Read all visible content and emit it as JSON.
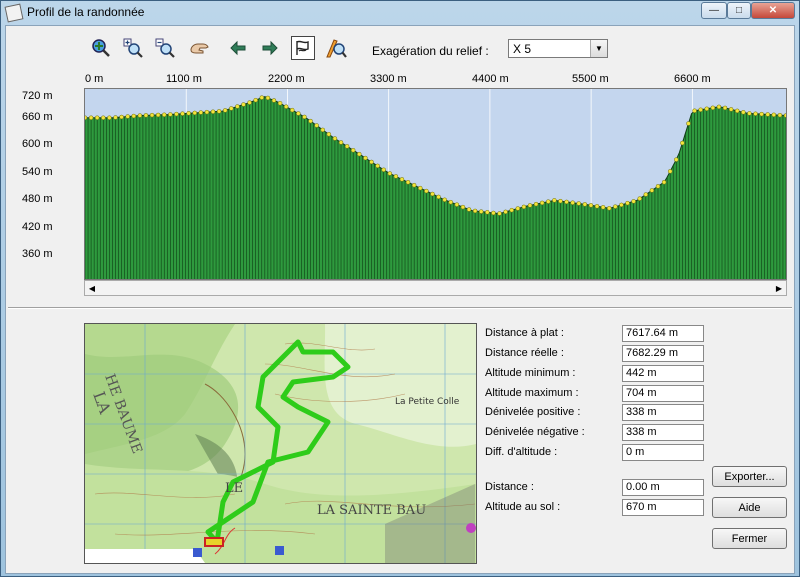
{
  "window": {
    "title": "Profil de la randonnée",
    "controls": {
      "minimize": "—",
      "maximize": "□",
      "close": "✕"
    }
  },
  "toolbar": {
    "items": [
      {
        "name": "zoom-extent-icon",
        "glyph": "⊕"
      },
      {
        "name": "zoom-in-icon",
        "glyph": "+"
      },
      {
        "name": "zoom-out-icon",
        "glyph": "−"
      },
      {
        "name": "pan-hand-icon",
        "glyph": "✋"
      },
      {
        "name": "arrow-left-icon",
        "glyph": "⇦"
      },
      {
        "name": "arrow-right-icon",
        "glyph": "⇨"
      },
      {
        "name": "profile-flag-icon",
        "glyph": "⚑"
      },
      {
        "name": "measure-tool-icon",
        "glyph": "⚲"
      }
    ],
    "relief_label": "Exagération du relief :",
    "relief_value": "X 5"
  },
  "chart_data": {
    "type": "area",
    "x_ticks": [
      "0 m",
      "1100 m",
      "2200 m",
      "3300 m",
      "4400 m",
      "5500 m",
      "6600 m"
    ],
    "y_ticks": [
      "720 m",
      "660 m",
      "600 m",
      "540 m",
      "480 m",
      "420 m",
      "360 m"
    ],
    "xlim": [
      0,
      7617.64
    ],
    "ylim": [
      300,
      730
    ],
    "grid": true,
    "fill_color": "#2e9a3e",
    "point_color": "#f2e53c",
    "sky_color": "#c4d6ee",
    "x": [
      0,
      300,
      600,
      900,
      1200,
      1500,
      1800,
      1950,
      2100,
      2400,
      2700,
      3000,
      3300,
      3600,
      3900,
      4200,
      4500,
      4800,
      5100,
      5400,
      5700,
      6000,
      6300,
      6450,
      6600,
      6900,
      7200,
      7617.64
    ],
    "y": [
      665,
      665,
      670,
      672,
      676,
      680,
      700,
      713,
      700,
      665,
      620,
      580,
      540,
      510,
      480,
      455,
      448,
      465,
      478,
      470,
      460,
      478,
      520,
      580,
      680,
      690,
      675,
      670
    ]
  },
  "stats": [
    {
      "label": "Distance à plat :",
      "value": "7617.64 m"
    },
    {
      "label": "Distance réelle :",
      "value": "7682.29 m"
    },
    {
      "label": "Altitude minimum :",
      "value": "442 m"
    },
    {
      "label": "Altitude maximum :",
      "value": "704 m"
    },
    {
      "label": "Dénivelée positive :",
      "value": "338 m"
    },
    {
      "label": "Dénivelée négative :",
      "value": "338 m"
    },
    {
      "label": "Diff. d'altitude :",
      "value": "0 m"
    }
  ],
  "cursor": [
    {
      "label": "Distance :",
      "value": "0.00 m"
    },
    {
      "label": "Altitude au sol :",
      "value": "670 m"
    }
  ],
  "buttons": {
    "export": "Exporter...",
    "help": "Aide",
    "close": "Fermer"
  },
  "map_labels": {
    "l1": "LA",
    "l2": "HE BAUME",
    "l3": "La Petite Colle",
    "l4": "LA SAINTE BAU",
    "l5": "LE"
  }
}
